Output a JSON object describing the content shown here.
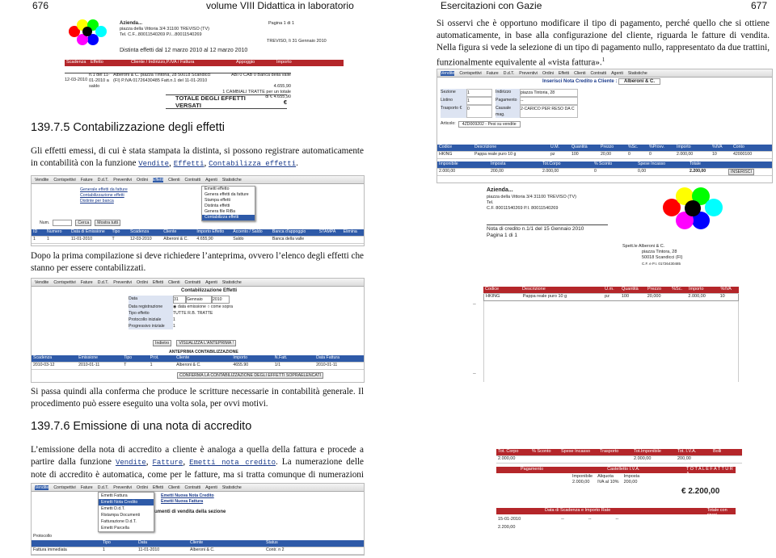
{
  "header": {
    "left_page_num": "676",
    "left_title": "volume VIII     Didattica in laboratorio",
    "right_title": "Esercitazioni con Gazie",
    "right_page_num": "677"
  },
  "left": {
    "section1_title": "139.7.5  Contabilizzazione degli effetti",
    "para1_text": "Gli effetti emessi, di cui è stata stampata la distinta, si possono registrare automaticamente in contabilità con la funzione ",
    "para1_code1": "Vendite",
    "para1_code2": "Effetti",
    "para1_code3": "Contabilizza effetti",
    "para2": "Dopo la prima compilazione si deve richiedere l’anteprima, ovvero l’elenco degli effetti che stanno per essere contabilizzati.",
    "para3": "Si passa quindi alla conferma che produce le scritture necessarie in contabilità generale. Il procedimento può essere eseguito una volta sola, per ovvi motivi.",
    "section2_title": "139.7.6  Emissione di una nota di accredito",
    "para4_text": "L’emissione della nota di accredito a cliente è analoga a quella della fattura e procede a partire dalla funzione ",
    "para4_code1": "Vendite",
    "para4_code2": "Fatture",
    "para4_code3": "Emetti nota credito",
    "para4_rest": ". La numerazione delle note di accredito è automatica, come per le fatture, ma si tratta comunque di numerazioni indipendenti."
  },
  "right": {
    "para_text": "Si osservi che è opportuno modificare il tipo di pagamento, perché quello che si ottiene automaticamente, in base alla configurazione del cliente, riguarda le fatture di vendita. Nella figura si vede la selezione di un tipo di pagamento nullo, rappresentato da due trattini, funzionalmente equivalente al «vista fattura».",
    "footnote_mark": "1"
  },
  "distinta": {
    "company": "Azienda...",
    "address": "piazza della Vittoria 3/4 31100 TREVISO (TV)",
    "tel": "Tel. C.F...80011540269 P.I...80011540269",
    "page": "Pagina 1 di 1",
    "city_date": "TREVISO, lì 31 Gennaio 2010",
    "title": "Distinta effetti dal 12 marzo 2010 al 12 marzo 2010",
    "cols": [
      "Scadenza",
      "Effetto",
      "Cliente / Indirizzo,P.IVA / Fattura",
      "Appoggio",
      "Importo"
    ],
    "row_date": "12-03-2010",
    "row_eff": "n.1 del 11-01-2010 a saldo",
    "row_client": "Alberoni & C. piazza Tintoria, 28 50018 Scandicci (FI) P.IVA 01726430485 Fatt.n.1 del 11-01-2010",
    "row_bank": "ABI 0 CAB 0 Banca della valle",
    "row_amount": "4.655,90",
    "row_total_line": "1 CAMBIALI TRATTE  per un totale di € 4.655,90",
    "total_label": "TOTALE DEGLI EFFETTI VERSATI",
    "total_currency": "€"
  },
  "shot_menu": {
    "items": [
      "Vendite",
      "Corrispettivi",
      "Fature",
      "D.d.T.",
      "Preventivi",
      "Ordini",
      "Effetti",
      "Clienti",
      "Contratti",
      "Agenti",
      "Statistiche"
    ]
  },
  "shot1": {
    "submenu": [
      "Generale effetti da fatture",
      "Contabilizzazione effetti",
      "Distinte per banca"
    ],
    "dropdown": [
      "Emetti effetto",
      "Genera effetti da fatture",
      "Stampa effetti",
      "Distinta effetti",
      "Genera file RiBa",
      "Contabilizza effetti"
    ],
    "search_label": "Num.",
    "btn_search": "Cerca",
    "btn_all": "Mostra tutti",
    "cols": [
      "ID",
      "Numero",
      "Data di Emissione",
      "Tipo",
      "Scadenza",
      "Cliente",
      "Importo Effetto",
      "Accento / Saldo",
      "Banca d'appoggio",
      "STAMPA",
      "Elimina"
    ],
    "row": [
      "1",
      "1",
      "11-01-2010",
      "T",
      "12-03-2010",
      "Alberoni & C.",
      "4.655,90",
      "Saldo",
      "Banca della valle",
      "",
      ""
    ]
  },
  "shot2": {
    "title": "Contabilizzazione Effetti",
    "fields": [
      "Data",
      "Data registrazione",
      "Tipo effetto",
      "Protocollo iniziale",
      "Progressivo iniziale"
    ],
    "day": "31",
    "month": "Gennaio",
    "year": "2010",
    "opt1": "data emissione",
    "opt2": "come sopra",
    "tipo_opts": "TUTTE  R.B.  TRATTE",
    "prot": "1",
    "prog": "1",
    "btn_back": "Indietro",
    "btn_preview": "VISUALIZZA L'ANTEPRIMA !",
    "preview_title": "ANTEPRIMA CONTABILIZZAZIONE",
    "cols": [
      "Scadenza",
      "Emissione",
      "Tipo",
      "Prot.",
      "Cliente",
      "Importo",
      "N.Fatt.",
      "Data Fattura"
    ],
    "row": [
      "2010-03-12",
      "2010-01-11",
      "T",
      "1",
      "Alberoni & C.",
      "4655.90",
      "1/1",
      "2010-01-11"
    ],
    "btn_confirm": "CONFERMA LA CONTABILIZZAZIONE DEGLI EFFETTI SOPRAELENCATI"
  },
  "shot3": {
    "menu": [
      "Emetti Fattura",
      "Emetti Nota Credito",
      "Emetti D.d.T.",
      "Ristampa Documenti",
      "Fatturazione D.d.T.",
      "Emetti Parcella"
    ],
    "header1": "Emetti Nuova Nota Credito",
    "header2": "Emetti Nuova Fattura",
    "labels": [
      "Protocollo",
      "Fattura immediata"
    ],
    "list_title": "umenti di vendita della sezione",
    "cols": [
      "Tipo",
      "Data",
      "Cliente",
      "Status"
    ],
    "row": [
      "1",
      "11-01-2010",
      "Alberoni & C.",
      "Contr. n 2"
    ]
  },
  "ncform": {
    "top_tab": "Vendite",
    "title": "Inserisci Nota Credito a Cliente :",
    "client": "Alberoni & C.",
    "labels": [
      "Sezione",
      "Indirizzo",
      "Listino",
      "Pagamento",
      "Trasporto €",
      "Causale mag.",
      "Tipo"
    ],
    "values": [
      "1",
      "piazza Tintoria, 28",
      "1",
      "--",
      "0",
      "2-CARICO PER RESO DA C",
      ""
    ],
    "article_label": "Articolo:",
    "article_val": "4ZD009202 - Pesi su vendite",
    "row_cols": [
      "Codice",
      "Descrizione",
      "U.M.",
      "Quantità",
      "Prezzo",
      "%Sc.",
      "%Provv.",
      "Importo",
      "%IVA",
      "Conto"
    ],
    "row": [
      "HKING",
      "Pappa reale puro 10 g",
      "pz",
      "100",
      "20,00",
      "0",
      "0",
      "2.000,00",
      "10",
      "42000100"
    ],
    "tot_cols": [
      "Imponibile",
      "Imposta",
      "Tot.Corpo",
      "% Sconto",
      "Spese Incasso",
      "Totale"
    ],
    "tot_row": [
      "2.000,00",
      "200,00",
      "2.000,00",
      "0",
      "0,00",
      "2.200,00"
    ],
    "btn_insert": "INSERISCI"
  },
  "nota": {
    "company": "Azienda...",
    "address": "piazza della Vittoria 3/4 31100 TREVISO (TV)",
    "tel": "Tel.",
    "cf": "C.F. 80011540269 P.I. 80011540269",
    "title": "Nota di credito n.1/1 del 15 Gennaio 2010",
    "page": "Pagina 1 di 1",
    "spett": "Spett.le",
    "client_name": "Alberoni & C.",
    "client_addr1": "piazza Tintora, 28",
    "client_addr2": "50018 Scandicci (FI)",
    "client_vat": "C.F. e P.I. 01726430485",
    "cols": [
      "Codice",
      "Descrizione",
      "U.m.",
      "Quantità",
      "Prezzo",
      "%Sc.",
      "Importo",
      "%IVA"
    ],
    "row": [
      "HKING",
      "Pappa reale puro 10 g",
      "pz",
      "100",
      "20,000",
      "",
      "2.000,00",
      "10"
    ],
    "tot_cols": [
      "Tot. Corpo",
      "% Sconto",
      "Spese Incasso",
      "Trasporto",
      "Tot.Imponibile",
      "Tot. I.V.A.",
      "Bolli"
    ],
    "tot_row": [
      "2.000,00",
      "",
      "",
      "",
      "2.000,00",
      "200,00",
      ""
    ],
    "pay_label": "Pagamento",
    "castle": "Castelletto I.V.A.",
    "totale_fattura": "T O T A L E   F A T T U R A",
    "iva_cols": [
      "Imponibile",
      "Aliquota",
      "Imposta"
    ],
    "iva_row": [
      "2.000,00",
      "IVA al 10%",
      "200,00"
    ],
    "grand_total": "€  2.200,00",
    "due_label": "Data di Scadenza e Importo Rate",
    "notes_label": "Totale con ripori",
    "due_date": "15-01-2010",
    "due_amount": "2.200,00",
    "dashes": "--"
  },
  "colors": {
    "blue": "#2e5aa8",
    "red": "#b4262a",
    "circle_palette": [
      "#ff0000",
      "#ffff00",
      "#00ff00",
      "#00ffff",
      "#0000ff",
      "#ff00ff",
      "#000000"
    ]
  }
}
